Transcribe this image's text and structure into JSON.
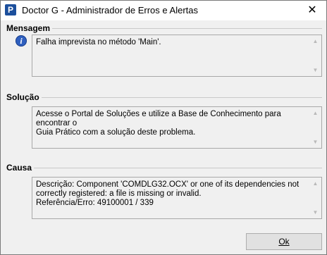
{
  "window": {
    "title": "Doctor G - Administrador de Erros e Alertas",
    "icon_letter": "P",
    "close_label": "✕"
  },
  "sections": {
    "mensagem": {
      "label": "Mensagem",
      "text": "Falha imprevista no método 'Main'.",
      "icon": "info-icon"
    },
    "solucao": {
      "label": "Solução",
      "text": "Acesse o Portal de Soluções e utilize a Base de Conhecimento para encontrar o\nGuia Prático com a solução deste problema."
    },
    "causa": {
      "label": "Causa",
      "text": "Descrição: Component 'COMDLG32.OCX' or one of its dependencies not\ncorrectly registered: a file is missing or invalid.\nReferência/Erro: 49100001 / 339"
    }
  },
  "buttons": {
    "ok_label": "Ok"
  },
  "colors": {
    "accent": "#1c4f9c",
    "info_icon": "#2f5fbf"
  }
}
